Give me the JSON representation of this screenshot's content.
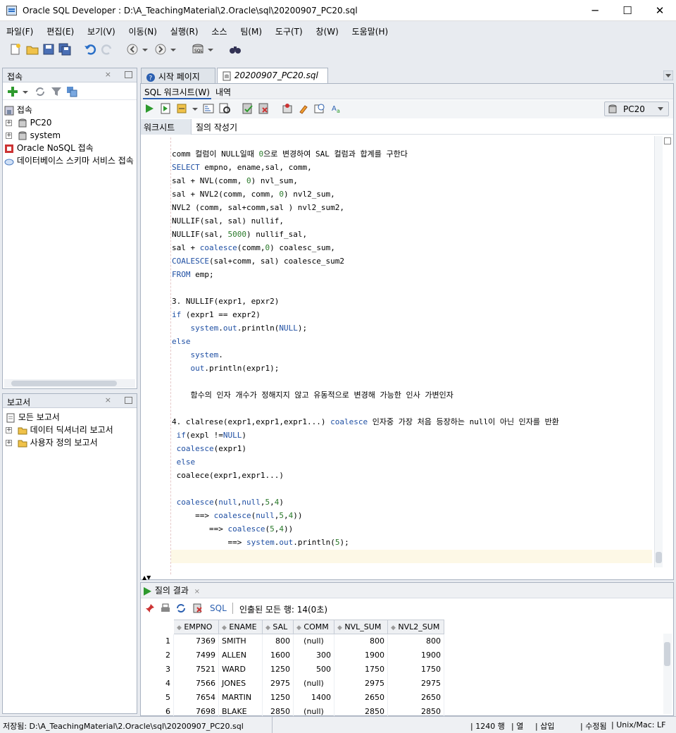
{
  "window": {
    "title": "Oracle SQL Developer : D:\\A_TeachingMaterial\\2.Oracle\\sql\\20200907_PC20.sql",
    "controls": {
      "minimize": "─",
      "maximize": "☐",
      "close": "✕"
    }
  },
  "menu": [
    "파일(F)",
    "편집(E)",
    "보기(V)",
    "이동(N)",
    "실행(R)",
    "소스",
    "팀(M)",
    "도구(T)",
    "창(W)",
    "도움말(H)"
  ],
  "connections_panel": {
    "title": "접속",
    "items": [
      {
        "label": "접속"
      },
      {
        "label": "PC20"
      },
      {
        "label": "system"
      },
      {
        "label": "Oracle NoSQL 접속"
      },
      {
        "label": "데이터베이스 스키마 서비스 접속"
      }
    ]
  },
  "reports_panel": {
    "title": "보고서",
    "items": [
      {
        "label": "모든 보고서"
      },
      {
        "label": "데이터 딕셔너리 보고서"
      },
      {
        "label": "사용자 정의 보고서"
      }
    ]
  },
  "editor_tabs": [
    "시작 페이지",
    "20200907_PC20.sql"
  ],
  "worksheet_tabs": [
    "SQL 워크시트(W)",
    "내역"
  ],
  "connection_select": "PC20",
  "sub_tabs": [
    "워크시트",
    "질의 작성기"
  ],
  "code_lines": [
    [
      {
        "t": "comm 컬럼이 NULL일때 "
      },
      {
        "t": "0",
        "c": "num"
      },
      {
        "t": "으로 변경하여 SAL 컬럼과 합계를 구한다"
      }
    ],
    [
      {
        "t": "SELECT",
        "c": "kw"
      },
      {
        "t": " empno, ename,sal, comm,"
      }
    ],
    [
      {
        "t": "sal + NVL(comm, "
      },
      {
        "t": "0",
        "c": "num"
      },
      {
        "t": ") nvl_sum,"
      }
    ],
    [
      {
        "t": "sal + NVL2(comm, comm, "
      },
      {
        "t": "0",
        "c": "num"
      },
      {
        "t": ") nvl2_sum,"
      }
    ],
    [
      {
        "t": "NVL2 (comm, sal+comm,sal ) nvl2_sum2,"
      }
    ],
    [
      {
        "t": "NULLIF(sal, sal) nullif,"
      }
    ],
    [
      {
        "t": "NULLIF(sal, "
      },
      {
        "t": "5000",
        "c": "num"
      },
      {
        "t": ") nullif_sal,"
      }
    ],
    [
      {
        "t": "sal + "
      },
      {
        "t": "coalesce",
        "c": "kw"
      },
      {
        "t": "(comm,"
      },
      {
        "t": "0",
        "c": "num"
      },
      {
        "t": ") coalesc_sum,"
      }
    ],
    [
      {
        "t": "COALESCE",
        "c": "kw"
      },
      {
        "t": "(sal+comm, sal) coalesce_sum2"
      }
    ],
    [
      {
        "t": "FROM",
        "c": "kw"
      },
      {
        "t": " emp;"
      }
    ],
    [
      {
        "t": ""
      }
    ],
    [
      {
        "t": "3. NULLIF(expr1, epxr2)"
      }
    ],
    [
      {
        "t": "if",
        "c": "kw"
      },
      {
        "t": " (expr1 == expr2)"
      }
    ],
    [
      {
        "t": "    "
      },
      {
        "t": "system",
        "c": "kw"
      },
      {
        "t": "."
      },
      {
        "t": "out",
        "c": "kw"
      },
      {
        "t": ".println("
      },
      {
        "t": "NULL",
        "c": "kw"
      },
      {
        "t": ");"
      }
    ],
    [
      {
        "t": "else",
        "c": "kw"
      }
    ],
    [
      {
        "t": "    "
      },
      {
        "t": "system",
        "c": "kw"
      },
      {
        "t": "."
      }
    ],
    [
      {
        "t": "    "
      },
      {
        "t": "out",
        "c": "kw"
      },
      {
        "t": ".println(expr1);"
      }
    ],
    [
      {
        "t": ""
      }
    ],
    [
      {
        "t": "    함수의 인자 개수가 정해지지 않고 유동적으로 변경해 가능한 인사 가변인자"
      }
    ],
    [
      {
        "t": ""
      }
    ],
    [
      {
        "t": "4. clalrese(expr1,expr1,expr1...) "
      },
      {
        "t": "coalesce",
        "c": "kw"
      },
      {
        "t": " 인자중 가장 처음 등장하는 null이 아닌 인자를 반환"
      }
    ],
    [
      {
        "t": " "
      },
      {
        "t": "if",
        "c": "kw"
      },
      {
        "t": "(expl !="
      },
      {
        "t": "NULL",
        "c": "kw"
      },
      {
        "t": ")"
      }
    ],
    [
      {
        "t": " "
      },
      {
        "t": "coalesce",
        "c": "kw"
      },
      {
        "t": "(expr1)"
      }
    ],
    [
      {
        "t": " "
      },
      {
        "t": "else",
        "c": "kw"
      }
    ],
    [
      {
        "t": " coalece(expr1,expr1...)"
      }
    ],
    [
      {
        "t": ""
      }
    ],
    [
      {
        "t": " "
      },
      {
        "t": "coalesce",
        "c": "kw"
      },
      {
        "t": "("
      },
      {
        "t": "null",
        "c": "kw"
      },
      {
        "t": ","
      },
      {
        "t": "null",
        "c": "kw"
      },
      {
        "t": ","
      },
      {
        "t": "5",
        "c": "num"
      },
      {
        "t": ","
      },
      {
        "t": "4",
        "c": "num"
      },
      {
        "t": ")"
      }
    ],
    [
      {
        "t": "     ==> "
      },
      {
        "t": "coalesce",
        "c": "kw"
      },
      {
        "t": "("
      },
      {
        "t": "null",
        "c": "kw"
      },
      {
        "t": ","
      },
      {
        "t": "5",
        "c": "num"
      },
      {
        "t": ","
      },
      {
        "t": "4",
        "c": "num"
      },
      {
        "t": "))"
      }
    ],
    [
      {
        "t": "        ==> "
      },
      {
        "t": "coalesce",
        "c": "kw"
      },
      {
        "t": "("
      },
      {
        "t": "5",
        "c": "num"
      },
      {
        "t": ","
      },
      {
        "t": "4",
        "c": "num"
      },
      {
        "t": "))"
      }
    ],
    [
      {
        "t": "            ==> "
      },
      {
        "t": "system",
        "c": "kw"
      },
      {
        "t": "."
      },
      {
        "t": "out",
        "c": "kw"
      },
      {
        "t": ".println("
      },
      {
        "t": "5",
        "c": "num"
      },
      {
        "t": ");"
      }
    ]
  ],
  "results": {
    "tab_label": "질의 결과",
    "sql_label": "SQL",
    "summary": "인출된 모든 행: 14(0초)",
    "columns": [
      "EMPNO",
      "ENAME",
      "SAL",
      "COMM",
      "NVL_SUM",
      "NVL2_SUM"
    ],
    "rows": [
      [
        "1",
        "7369",
        "SMITH",
        "800",
        "(null)",
        "800",
        "800"
      ],
      [
        "2",
        "7499",
        "ALLEN",
        "1600",
        "300",
        "1900",
        "1900"
      ],
      [
        "3",
        "7521",
        "WARD",
        "1250",
        "500",
        "1750",
        "1750"
      ],
      [
        "4",
        "7566",
        "JONES",
        "2975",
        "(null)",
        "2975",
        "2975"
      ],
      [
        "5",
        "7654",
        "MARTIN",
        "1250",
        "1400",
        "2650",
        "2650"
      ],
      [
        "6",
        "7698",
        "BLAKE",
        "2850",
        "(null)",
        "2850",
        "2850"
      ]
    ]
  },
  "status": {
    "saved": "저장됨: D:\\A_TeachingMaterial\\2.Oracle\\sql\\20200907_PC20.sql",
    "line": "1240 행",
    "col": "열",
    "mode": "삽입",
    "modified": "수정됨",
    "eol": "Unix/Mac: LF"
  }
}
